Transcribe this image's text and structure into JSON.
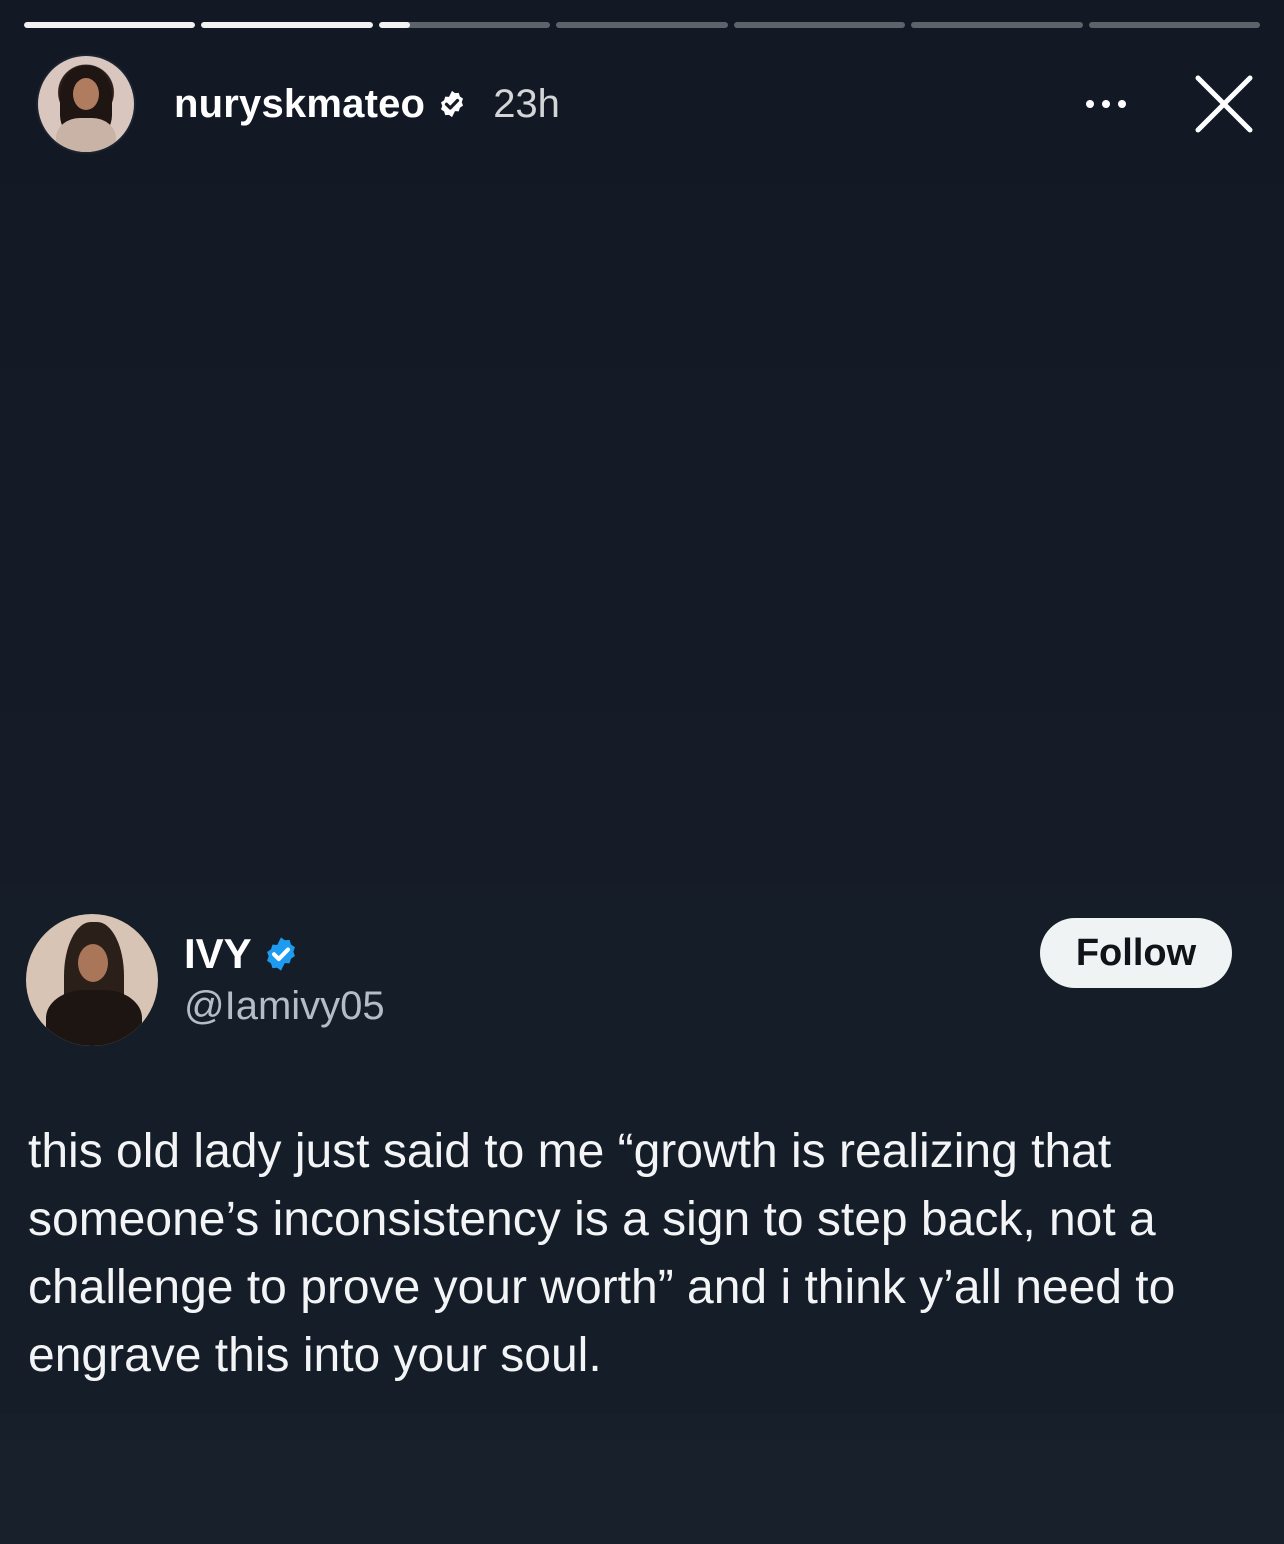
{
  "story": {
    "progress_segments": [
      1,
      1,
      0.18,
      0,
      0,
      0,
      0
    ],
    "username": "nuryskmateo",
    "time": "23h",
    "icons": {
      "verified": "verified-badge-icon",
      "more": "more-horizontal-icon",
      "close": "close-icon"
    }
  },
  "tweet": {
    "name": "IVY",
    "handle": "@Iamivy05",
    "follow_label": "Follow",
    "text": "this old lady just said to me “growth is realizing that someone’s inconsistency is a sign to step back, not a challenge to prove your worth” and i think y’all need to engrave this into your soul.",
    "colors": {
      "verified": "#1d9bf0",
      "follow_bg": "#eff3f4"
    }
  }
}
